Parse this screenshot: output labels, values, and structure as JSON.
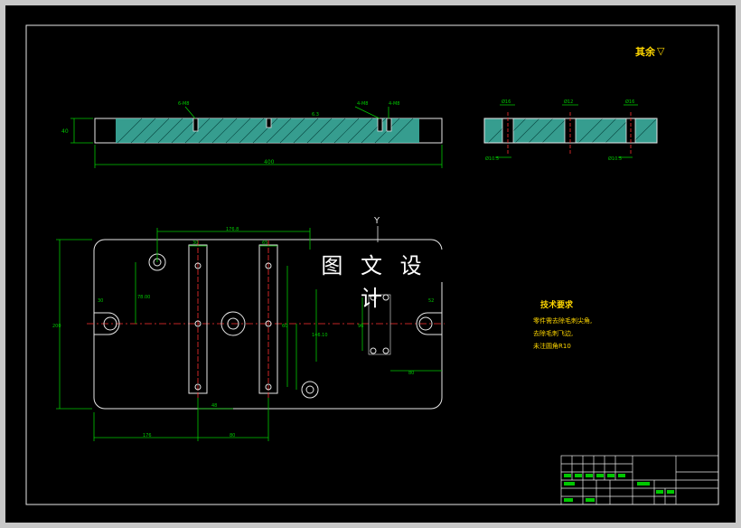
{
  "drawing": {
    "watermark": "图 文 设 计",
    "roughness_note": "其余",
    "roughness_symbol": "▽",
    "axis_label": "Y",
    "tech_req": {
      "title": "技术要求",
      "lines": [
        "零件需去除毛刺尖角,",
        "去除毛刺飞边,",
        "未注圆角R10"
      ]
    },
    "top_view": {
      "overall_length": "400",
      "height_left": "40",
      "callout_left": "6-M8\n深10",
      "callout_mid": "4-M8\n深10",
      "callout_right": "4-M8\n深10",
      "roughness_mark": "6.3"
    },
    "side_view": {
      "dim_a": "Ø16",
      "dim_b": "Ø12",
      "dim_c": "Ø16",
      "dim_d": "Ø10.5",
      "dim_e": "Ø10.5"
    },
    "plan_view": {
      "dim_top": "176.8",
      "dim_65": "65",
      "dim_30": "30",
      "dim_left_30": "30",
      "dim_height": "200",
      "dim_78": "78.00",
      "dim_140": "146.10",
      "dim_60": "60",
      "dim_48": "48",
      "dim_bottom_176": "176",
      "dim_bottom_80": "80",
      "dim_right_96": "96",
      "dim_right_80": "80",
      "dim_right_52": "52"
    },
    "title_block": {
      "cells": [
        "",
        "",
        "",
        "",
        "",
        ""
      ]
    }
  }
}
